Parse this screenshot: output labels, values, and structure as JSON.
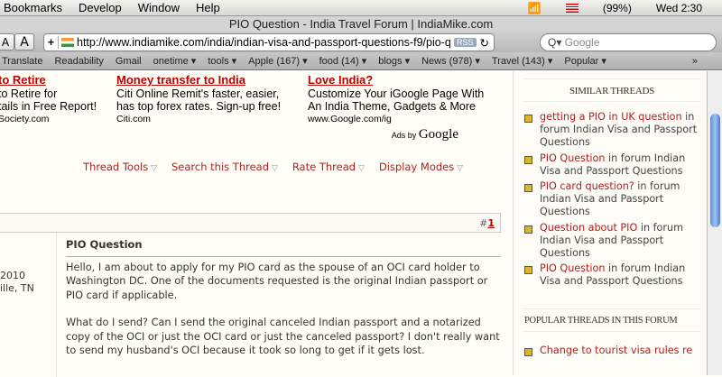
{
  "menubar": {
    "items": [
      "Bookmarks",
      "Develop",
      "Window",
      "Help"
    ],
    "battery": "(99%)",
    "clock": "Wed 2:30"
  },
  "window": {
    "title": "PIO Question - India Travel Forum | IndiaMike.com"
  },
  "toolbar": {
    "font_small": "A",
    "font_large": "A",
    "add": "+",
    "url": "http://www.indiamike.com/india/indian-visa-and-passport-questions-f9/pio-questio",
    "rss": "RSS",
    "reload": "↻",
    "search_placeholder": "Google"
  },
  "bookmarks": [
    "Translate",
    "Readability",
    "Gmail",
    "onetime ▾",
    "tools ▾",
    "Apple (167) ▾",
    "food (14) ▾",
    "blogs ▾",
    "News (978) ▾",
    "Travel (143) ▾",
    "Popular ▾"
  ],
  "ads": [
    {
      "title": "to Retire",
      "l1": "to Retire for",
      "l2": "tails in Free Report!",
      "url": "Society.com"
    },
    {
      "title": "Money transfer to India",
      "l1": "Citi Online Remit's faster, easier,",
      "l2": "has top forex rates. Sign-up free!",
      "url": "Citi.com"
    },
    {
      "title": "Love India?",
      "l1": "Customize Your iGoogle Page With",
      "l2": "An India Theme, Gadgets & More",
      "url": "www.Google.com/ig"
    }
  ],
  "ads_by": {
    "prefix": "Ads by",
    "brand": "Google"
  },
  "thread_tools": [
    "Thread Tools",
    "Search this Thread",
    "Rate Thread",
    "Display Modes"
  ],
  "post": {
    "num_prefix": "#",
    "num": "1",
    "user_line1": "2010",
    "user_line2": "ille, TN",
    "title": "PIO Question",
    "p1": "Hello, I am about to apply for my PIO card as the spouse of an OCI card holder to Washington DC. One of the documents requested is the original Indian passport or PIO card if applicable.",
    "p2": "What do I send? Can I send the original canceled Indian passport and a notarized copy of the OCI or just the OCI card or just the canceled passport? I don't really want to send my husband's OCI because it took so long to get if it gets lost."
  },
  "sidebar": {
    "similar_title": "SIMILAR THREADS",
    "similar": [
      {
        "link": "getting a PIO in UK question",
        "rest": " in forum Indian Visa and Passport Questions"
      },
      {
        "link": "PIO Question",
        "rest": " in forum Indian Visa and Passport Questions"
      },
      {
        "link": "PIO card question?",
        "rest": " in forum Indian Visa and Passport Questions"
      },
      {
        "link": "Question about PIO",
        "rest": " in forum Indian Visa and Passport Questions"
      },
      {
        "link": "PIO Question",
        "rest": " in forum Indian Visa and Passport Questions"
      }
    ],
    "popular_title": "POPULAR THREADS IN THIS FORUM",
    "popular": [
      {
        "link": "Change to tourist visa rules re"
      }
    ]
  }
}
